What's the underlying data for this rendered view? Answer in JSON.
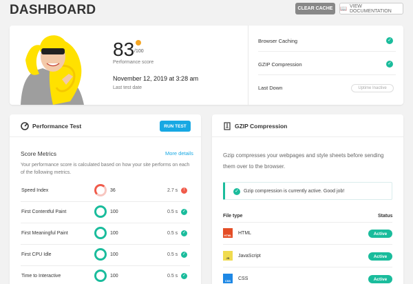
{
  "header": {
    "title": "DASHBOARD",
    "clear_cache": "CLEAR CACHE",
    "view_docs": "VIEW DOCUMENTATION"
  },
  "summary": {
    "score": "83",
    "score_max": "/100",
    "score_label": "Performance score",
    "test_date": "November 12, 2019 at 3:28 am",
    "test_date_label": "Last test date",
    "rows": [
      {
        "label": "Browser Caching",
        "status": "ok"
      },
      {
        "label": "GZIP Compression",
        "status": "ok"
      },
      {
        "label": "Last Down",
        "status": "Uptime Inactive"
      }
    ]
  },
  "performance": {
    "title": "Performance Test",
    "run_button": "RUN TEST",
    "metrics_title": "Score Metrics",
    "more_details": "More details",
    "description": "Your performance score is calculated based on how your site performs on each of the following metrics.",
    "metrics": [
      {
        "name": "Speed Index",
        "score": "36",
        "time": "2.7 s",
        "status": "warn",
        "ring_color": "#f05a4a"
      },
      {
        "name": "First Contentful Paint",
        "score": "100",
        "time": "0.5 s",
        "status": "ok",
        "ring_color": "#1abc9c"
      },
      {
        "name": "First Meaningful Paint",
        "score": "100",
        "time": "0.5 s",
        "status": "ok",
        "ring_color": "#1abc9c"
      },
      {
        "name": "First CPU Idle",
        "score": "100",
        "time": "0.5 s",
        "status": "ok",
        "ring_color": "#1abc9c"
      },
      {
        "name": "Time to Interactive",
        "score": "100",
        "time": "0.5 s",
        "status": "ok",
        "ring_color": "#1abc9c"
      }
    ]
  },
  "gzip": {
    "title": "GZIP Compression",
    "description": "Gzip compresses your webpages and style sheets before sending them over to the browser.",
    "notice": "Gzip compression is currently active. Good job!",
    "col_file_type": "File type",
    "col_status": "Status",
    "files": [
      {
        "name": "HTML",
        "icon_label": "HTML",
        "icon_color": "#e44d26",
        "status": "Active"
      },
      {
        "name": "JavaScript",
        "icon_label": "JS",
        "icon_color": "#f0db4f",
        "status": "Active"
      },
      {
        "name": "CSS",
        "icon_label": "CSS",
        "icon_color": "#1e88e5",
        "status": "Active"
      }
    ]
  },
  "colors": {
    "accent": "#17a8e3",
    "success": "#1abc9c",
    "warning": "#f05a4a",
    "score_dot": "#f5a623"
  }
}
